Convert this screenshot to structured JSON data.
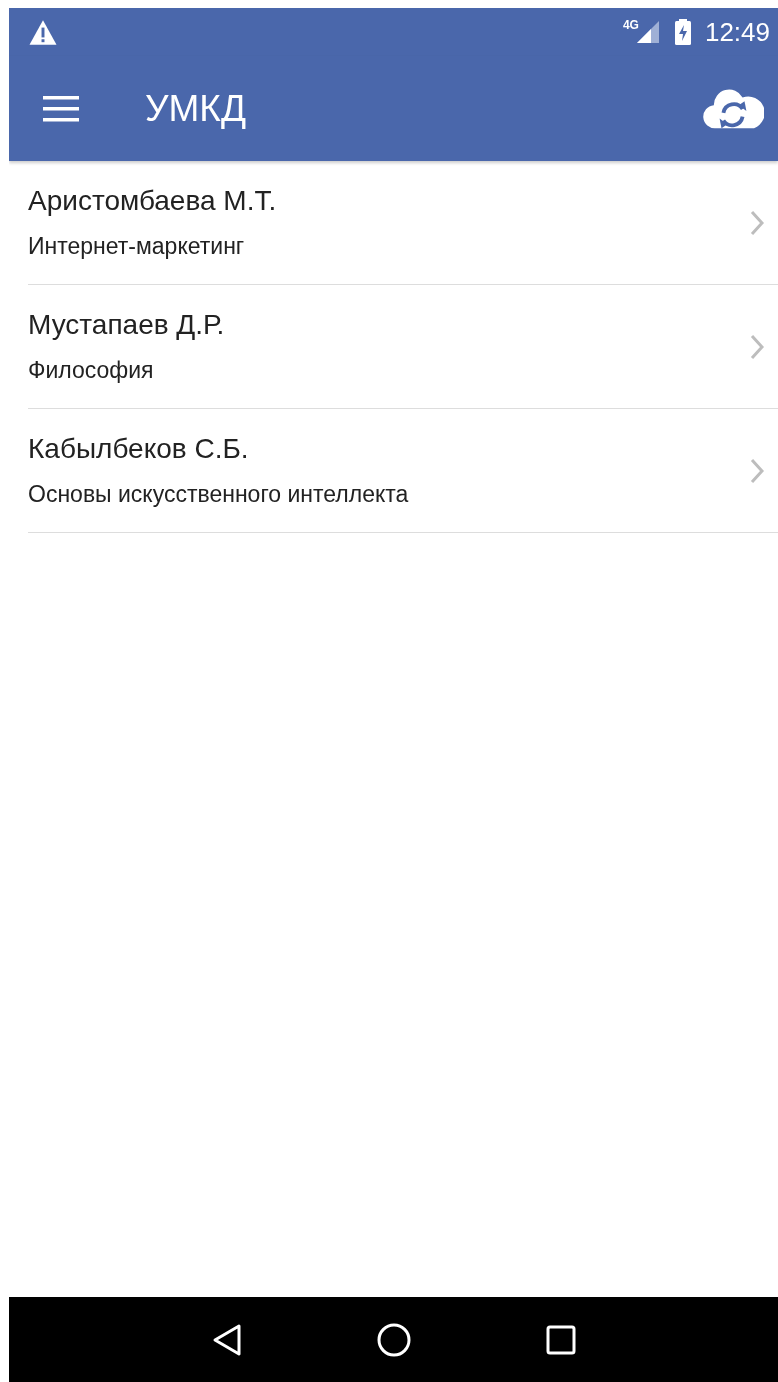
{
  "status_bar": {
    "network": "4G",
    "time": "12:49"
  },
  "app_bar": {
    "title": "УМКД"
  },
  "items": [
    {
      "title": "Аристомбаева М.Т.",
      "subtitle": "Интернет-маркетинг"
    },
    {
      "title": "Мустапаев Д.Р.",
      "subtitle": "Философия"
    },
    {
      "title": "Кабылбеков С.Б.",
      "subtitle": "Основы искусственного интеллекта"
    }
  ]
}
